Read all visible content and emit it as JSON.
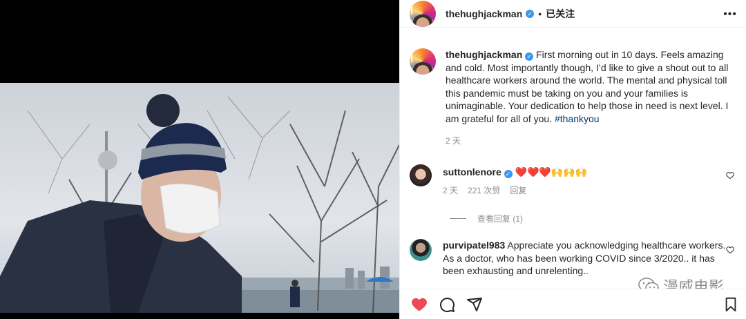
{
  "post": {
    "author": "thehughjackman",
    "follow_state": "已关注",
    "dot": "•",
    "caption_text": "First morning out in 10 days. Feels amazing and cold. Most importantly though, I’d like to give a shout out to all healthcare workers around the world. The mental and physical toll this pandemic must be taking on you and your families is unimaginable. Your dedication to help those in need is next level. I am grateful for all of you.",
    "hashtag": "#thankyou",
    "time": "2 天"
  },
  "comments": [
    {
      "user": "suttonlenore",
      "text": "❤️❤️❤️🙌🙌🙌",
      "time": "2 天",
      "likes": "221 次赞",
      "reply": "回复",
      "view_replies": "查看回复 (1)"
    },
    {
      "user": "purvipatel983",
      "text": "Appreciate you acknowledging healthcare workers. As a doctor, who has been working COVID since 3/2020.. it has been exhausting and unrelenting.."
    }
  ],
  "watermark": "漫威电影",
  "icons": {
    "more": "more-icon",
    "like": "heart-filled-icon",
    "comment": "comment-icon",
    "share": "share-icon",
    "save": "bookmark-icon"
  },
  "colors": {
    "like": "#ed4956",
    "verified": "#3897f0",
    "hashtag": "#00376b"
  }
}
